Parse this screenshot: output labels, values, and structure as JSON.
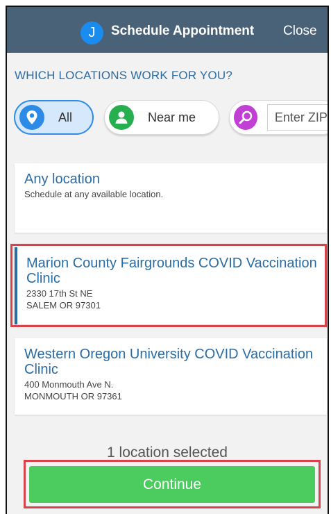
{
  "header": {
    "avatar_initial": "J",
    "title": "Schedule Appointment",
    "close_label": "Close"
  },
  "question": "WHICH LOCATIONS WORK FOR YOU?",
  "filters": {
    "all_label": "All",
    "near_label": "Near me",
    "zip_placeholder": "Enter ZIP",
    "selected": "All"
  },
  "locations": [
    {
      "name": "Any location",
      "line1": "Schedule at any available location.",
      "line2": "",
      "selected": false
    },
    {
      "name": "Marion County Fairgrounds COVID Vaccination Clinic",
      "line1": "2330 17th St NE",
      "line2": "SALEM OR 97301",
      "selected": true
    },
    {
      "name": "Western Oregon University COVID Vaccination Clinic",
      "line1": "400 Monmouth Ave N.",
      "line2": "MONMOUTH OR 97361",
      "selected": false
    }
  ],
  "selection_status": "1 location selected",
  "continue_label": "Continue",
  "colors": {
    "header_bg": "#4a6277",
    "accent_blue": "#2a6ca4",
    "avatar_blue": "#1a8cf0",
    "near_icon_green": "#27ae4f",
    "zip_icon_magenta": "#c13fd4",
    "continue_green": "#4ccc5e",
    "highlight_red": "#d9424a"
  },
  "icons": {
    "all": "location-pin-icon",
    "near": "person-icon",
    "zip": "search-icon"
  }
}
